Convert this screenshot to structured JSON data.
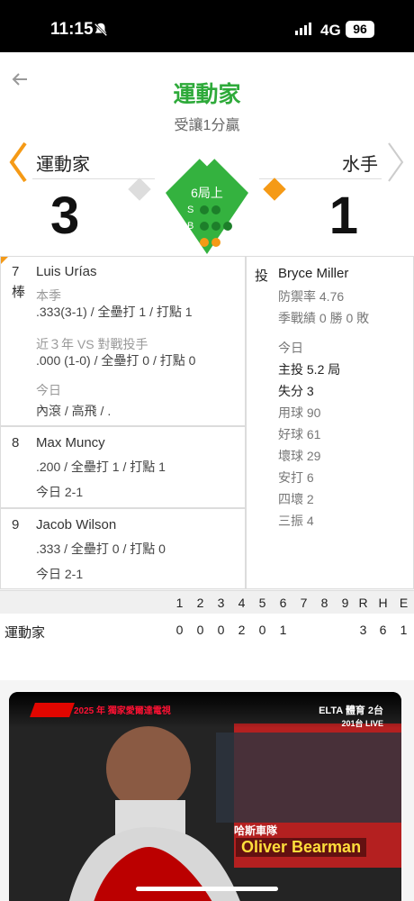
{
  "status": {
    "time": "11:15",
    "network": "4G",
    "battery": "96",
    "bell_icon": "bell-slash-icon",
    "signal_icon": "signal-icon"
  },
  "header": {
    "back_icon": "back-arrow-icon",
    "title": "運動家",
    "subtitle": "受讓1分贏",
    "team_left": "運動家",
    "team_right": "水手",
    "score_left": "3",
    "score_right": "1",
    "inning": "6局上",
    "counts": {
      "S": "S",
      "B": "B",
      "O": "O"
    },
    "colors": {
      "green": "#2eaa3a",
      "orange": "#f59a16"
    }
  },
  "lineup": {
    "batters": [
      {
        "order": "7",
        "extra": "棒",
        "name": "Luis Urías",
        "sections": [
          "本季",
          ".333(3-1)",
          "/ 全壘打 1",
          "/ 打點 1",
          "近３年 VS 對戰投手",
          ".000 (1-0)",
          "/ 全壘打 0",
          "/ 打點 0",
          "今日",
          "內滾 / 高飛 / ."
        ]
      },
      {
        "order": "8",
        "name": "Max Muncy",
        "line1": ".200 / 全壘打 1 / 打點 1",
        "today": "今日 2-1"
      },
      {
        "order": "9",
        "name": "Jacob Wilson",
        "line1": ".333 / 全壘打 0 / 打點 0",
        "today": "今日 2-1"
      }
    ],
    "pitcher": {
      "label": "投",
      "name": "Bryce Miller",
      "lines": [
        "防禦率 4.76",
        "季戰績 0 勝 0 敗",
        "今日",
        "主投 5.2 局",
        "失分 3",
        "用球 90",
        "好球 61",
        "壞球 29",
        "安打 6",
        "四壞 2",
        "三振 4"
      ]
    }
  },
  "scoreboard": {
    "header": [
      "1",
      "2",
      "3",
      "4",
      "5",
      "6",
      "7",
      "8",
      "9",
      "R",
      "H",
      "E"
    ],
    "rows": [
      {
        "team": "運動家",
        "scores": [
          "0",
          "0",
          "0",
          "2",
          "0",
          "1",
          "",
          "",
          "",
          "3",
          "6",
          "1"
        ]
      }
    ]
  },
  "video": {
    "left_brand": "F1",
    "left_text": "2025 年\n獨家愛爾達電視",
    "right_brand": "ELTA 體育 2台",
    "right_sub": "201台 LIVE",
    "caption_top": "哈斯車隊",
    "caption_name": "Oliver Bearman"
  }
}
